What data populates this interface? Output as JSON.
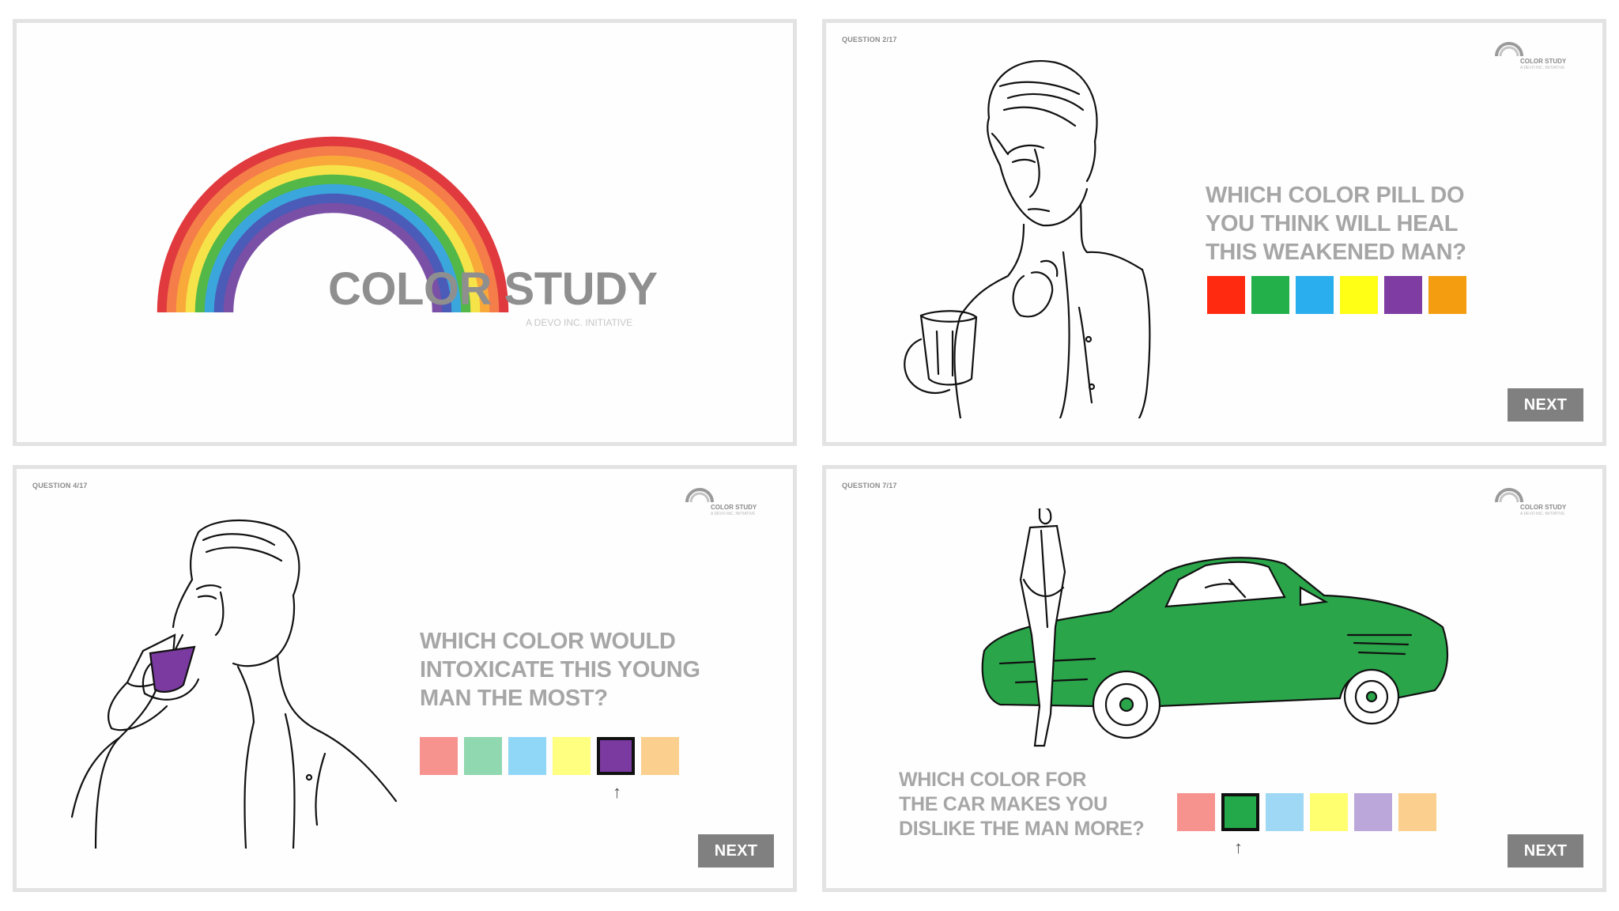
{
  "app": {
    "title": "COLOR STUDY",
    "subtitle": "A DEVO INC. INITIATIVE",
    "rainbow_colors": [
      "#e03a3e",
      "#f47d4a",
      "#f9a93a",
      "#f6e34a",
      "#53b848",
      "#3aa6dc",
      "#4b5bb8",
      "#7a4fa6"
    ]
  },
  "logo": {
    "title": "COLOR STUDY",
    "subtitle": "A DEVO INC. INITIATIVE"
  },
  "questions": [
    {
      "number": "QUESTION 2/17",
      "lines": [
        "WHICH COLOR PILL DO",
        "YOU THINK WILL HEAL",
        "THIS WEAKENED MAN?"
      ],
      "swatches": [
        "#ff2a10",
        "#23b04a",
        "#2aaeee",
        "#ffff16",
        "#7f3ca3",
        "#f59d10"
      ],
      "selected_index": null,
      "next_label": "NEXT"
    },
    {
      "number": "QUESTION 4/17",
      "lines": [
        "WHICH COLOR WOULD",
        "INTOXICATE THIS YOUNG",
        "MAN THE MOST?"
      ],
      "swatches": [
        "#f7938f",
        "#8fd8b0",
        "#8fd6f7",
        "#ffff80",
        "#7a3aa0",
        "#fbd08f"
      ],
      "selected_index": 4,
      "next_label": "NEXT"
    },
    {
      "number": "QUESTION 7/17",
      "lines": [
        "WHICH COLOR FOR",
        "THE CAR MAKES YOU",
        "DISLIKE THE MAN MORE?"
      ],
      "swatches": [
        "#f7938f",
        "#23a84a",
        "#9ed8f5",
        "#ffff70",
        "#bca7da",
        "#fbd08f"
      ],
      "selected_index": 1,
      "next_label": "NEXT"
    }
  ],
  "colors": {
    "car_green": "#2aa54a",
    "drink_purple": "#7a3aa0",
    "next_bg": "#808080"
  },
  "icons": [
    "rainbow-logo",
    "selection-arrow-icon"
  ]
}
